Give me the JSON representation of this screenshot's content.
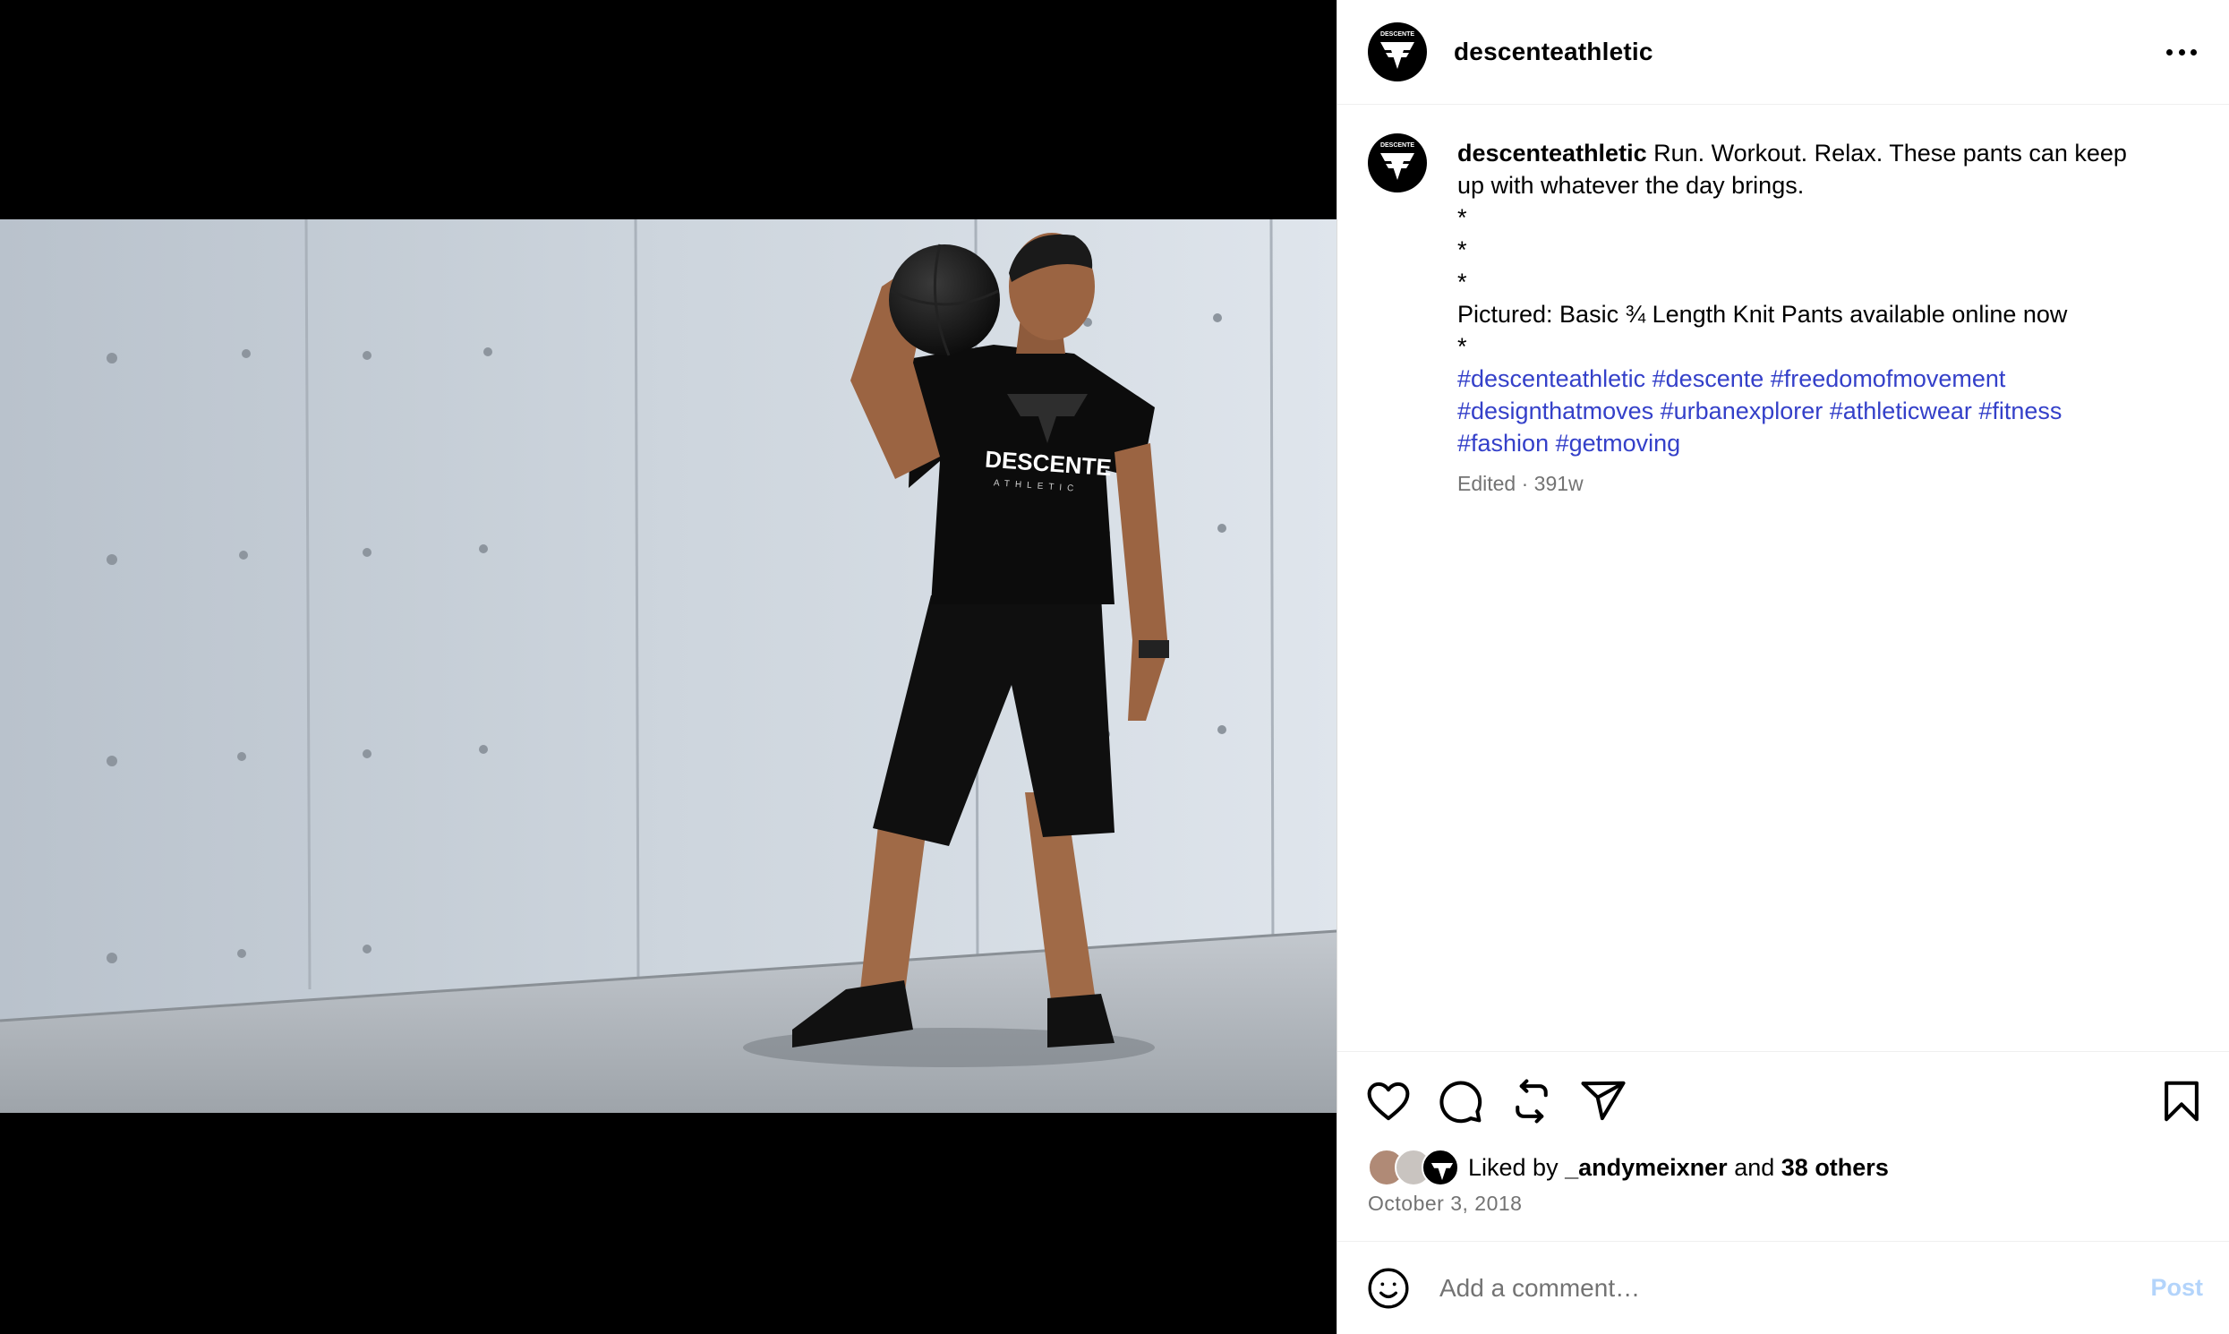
{
  "post": {
    "author": "descenteathletic",
    "avatar_text": "DESCENTE",
    "caption": {
      "username": "descenteathletic",
      "lines": [
        "Run. Workout. Relax. These pants can keep",
        "up with whatever the day brings.",
        "*",
        "*",
        "*",
        "Pictured: Basic ¾ Length Knit Pants available online now",
        "*"
      ],
      "hashtags": [
        "#descenteathletic #descente #freedomofmovement",
        "#designthatmoves #urbanexplorer #athleticwear #fitness",
        "#fashion #getmoving"
      ],
      "meta": "Edited · 391w"
    },
    "photo": {
      "shirt_brand": "DESCENTE",
      "shirt_sub": "ATHLETIC"
    }
  },
  "actions": {
    "icons": [
      "heart-icon",
      "comment-icon",
      "repost-icon",
      "share-icon",
      "bookmark-icon"
    ]
  },
  "likes": {
    "prefix": "Liked by",
    "user": "_andymeixner",
    "and": "and",
    "others": "38 others"
  },
  "date": "October 3, 2018",
  "comment_box": {
    "placeholder": "Add a comment…",
    "post_label": "Post"
  },
  "colors": {
    "hashtag": "#3440c9",
    "muted": "#737373",
    "post_disabled": "#b3d4fb",
    "divider": "#efefef"
  }
}
